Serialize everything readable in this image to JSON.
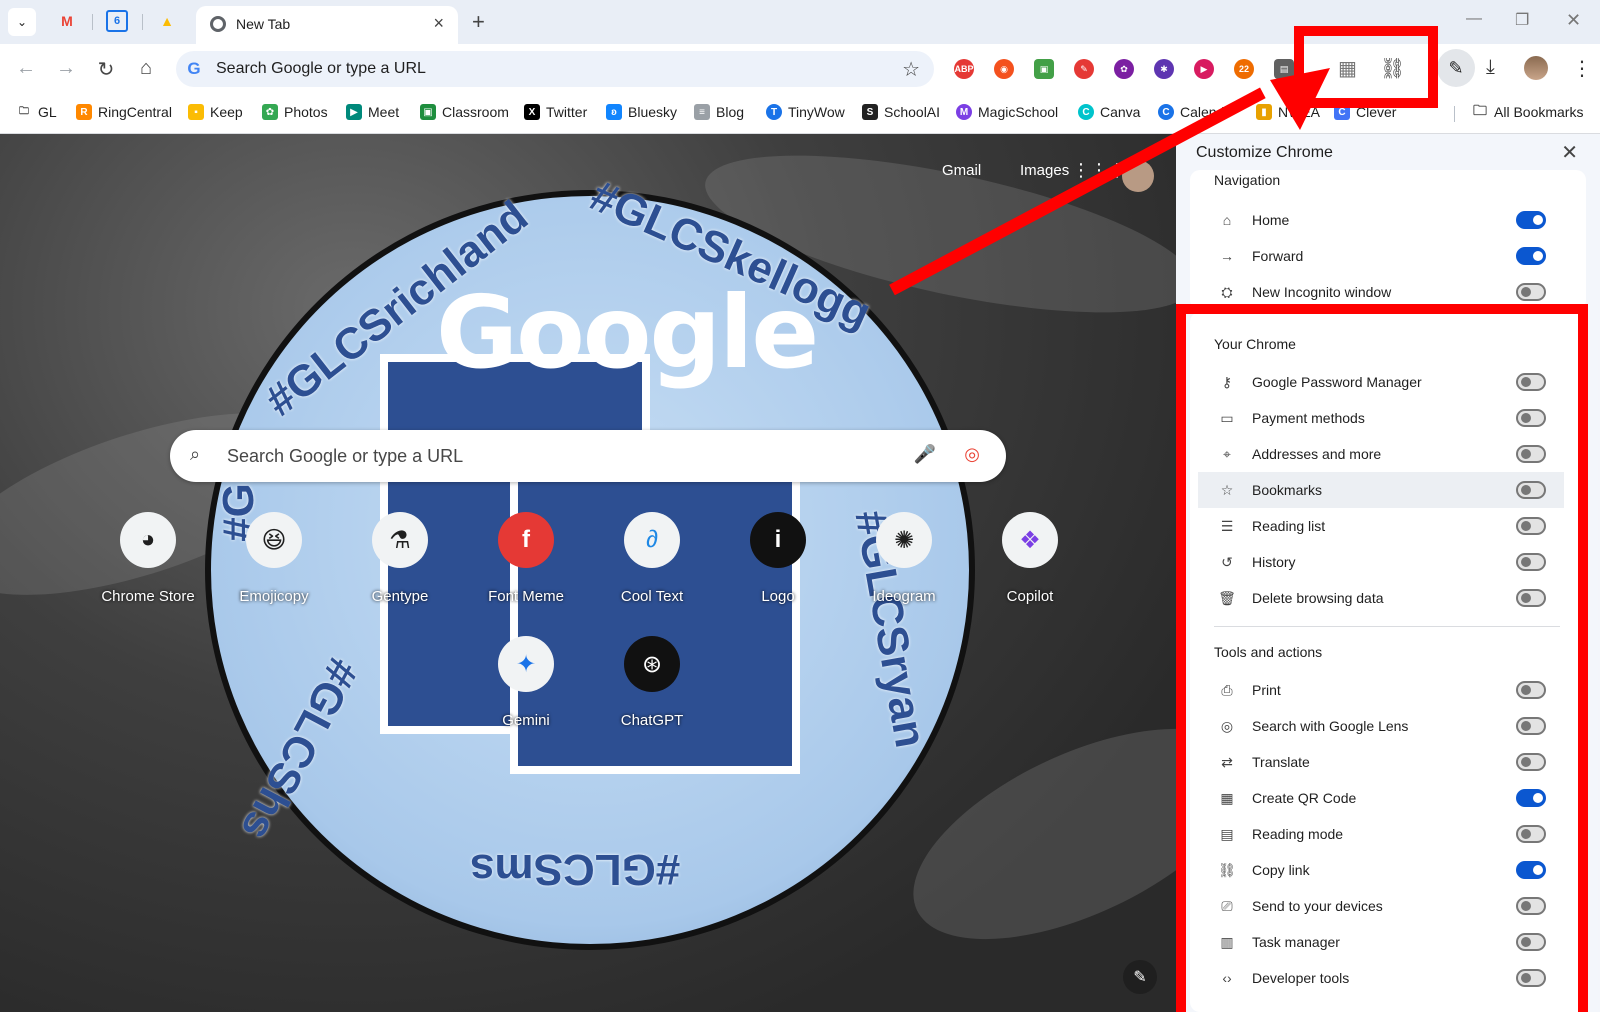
{
  "tabs": {
    "active_title": "New Tab",
    "pinned": [
      "M",
      "6",
      "▲"
    ]
  },
  "toolbar": {
    "omnibox_placeholder": "Search Google or type a URL",
    "extensions": [
      {
        "label": "ABP",
        "color": "#e53935"
      },
      {
        "label": "◉",
        "color": "#f4511e"
      },
      {
        "label": "▣",
        "color": "#43a047"
      },
      {
        "label": "✎",
        "color": "#e53935"
      },
      {
        "label": "✿",
        "color": "#7b1fa2"
      },
      {
        "label": "✱",
        "color": "#5e35b1"
      },
      {
        "label": "▶",
        "color": "#d81b60"
      },
      {
        "label": "22",
        "color": "#ef6c00"
      },
      {
        "label": "▤",
        "color": "#616161"
      }
    ]
  },
  "bookmarks": [
    {
      "label": "GL",
      "color": "#5f6368"
    },
    {
      "label": "RingCentral",
      "color": "#ff8800"
    },
    {
      "label": "Keep",
      "color": "#fbbc04"
    },
    {
      "label": "Photos",
      "color": "#34a853"
    },
    {
      "label": "Meet",
      "color": "#00897b"
    },
    {
      "label": "Classroom",
      "color": "#1e8e3e"
    },
    {
      "label": "Twitter",
      "color": "#000000"
    },
    {
      "label": "Bluesky",
      "color": "#1185fe"
    },
    {
      "label": "Blog",
      "color": "#5f6368"
    },
    {
      "label": "TinyWow",
      "color": "#1a73e8"
    },
    {
      "label": "SchoolAI",
      "color": "#222222"
    },
    {
      "label": "MagicSchool",
      "color": "#7b3fe4"
    },
    {
      "label": "Canva",
      "color": "#00c4cc"
    },
    {
      "label": "Calend",
      "color": "#1a73e8"
    },
    {
      "label": "NWEA",
      "color": "#e8a100"
    },
    {
      "label": "Clever",
      "color": "#4274f6"
    }
  ],
  "bookmarks_all": "All Bookmarks",
  "ntp": {
    "gmail": "Gmail",
    "images": "Images",
    "google_logo": "Google",
    "search_placeholder": "Search Google or type a URL",
    "ring_texts": [
      "#GLCSrichland",
      "#GLCSkellogg",
      "#GLCSryan",
      "#GLCSms",
      "#GLCShs",
      "#GL"
    ],
    "tiles": [
      {
        "label": "Chrome Store",
        "icon": "◕"
      },
      {
        "label": "Emojicopy",
        "icon": "😆"
      },
      {
        "label": "Gentype",
        "icon": "⚗"
      },
      {
        "label": "Font Meme",
        "icon": "f"
      },
      {
        "label": "Cool Text",
        "icon": "∂"
      },
      {
        "label": "Logo",
        "icon": "i"
      },
      {
        "label": "Ideogram",
        "icon": "✺"
      },
      {
        "label": "Copilot",
        "icon": "❖"
      },
      {
        "label": "Gemini",
        "icon": "✦"
      },
      {
        "label": "ChatGPT",
        "icon": "⊛"
      }
    ]
  },
  "panel": {
    "title": "Customize Chrome",
    "navigation_title": "Navigation",
    "navigation": [
      {
        "label": "Home",
        "icon": "⌂",
        "on": true
      },
      {
        "label": "Forward",
        "icon": "→",
        "on": true
      },
      {
        "label": "New Incognito window",
        "icon": "⛭",
        "on": false
      }
    ],
    "your_chrome_title": "Your Chrome",
    "your_chrome": [
      {
        "label": "Google Password Manager",
        "icon": "⚷",
        "on": false
      },
      {
        "label": "Payment methods",
        "icon": "▭",
        "on": false
      },
      {
        "label": "Addresses and more",
        "icon": "⌖",
        "on": false
      },
      {
        "label": "Bookmarks",
        "icon": "☆",
        "on": false
      },
      {
        "label": "Reading list",
        "icon": "☰",
        "on": false
      },
      {
        "label": "History",
        "icon": "↺",
        "on": false
      },
      {
        "label": "Delete browsing data",
        "icon": "🗑",
        "on": false
      }
    ],
    "tools_title": "Tools and actions",
    "tools": [
      {
        "label": "Print",
        "icon": "⎙",
        "on": false
      },
      {
        "label": "Search with Google Lens",
        "icon": "◎",
        "on": false
      },
      {
        "label": "Translate",
        "icon": "⇄",
        "on": false
      },
      {
        "label": "Create QR Code",
        "icon": "▦",
        "on": true
      },
      {
        "label": "Reading mode",
        "icon": "▤",
        "on": false
      },
      {
        "label": "Copy link",
        "icon": "⛓",
        "on": true
      },
      {
        "label": "Send to your devices",
        "icon": "⎚",
        "on": false
      },
      {
        "label": "Task manager",
        "icon": "▥",
        "on": false
      },
      {
        "label": "Developer tools",
        "icon": "‹›",
        "on": false
      }
    ]
  },
  "annotation_color": "#ff0000"
}
